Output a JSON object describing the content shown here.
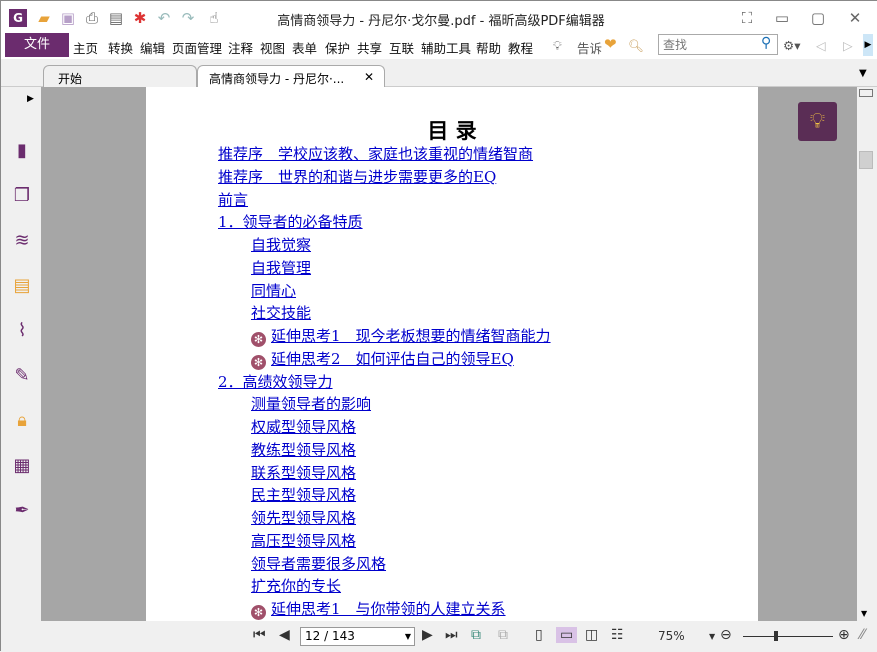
{
  "window": {
    "title": "高情商领导力 - 丹尼尔·戈尔曼.pdf - 福昕高级PDF编辑器"
  },
  "menu": {
    "file": "文件",
    "items": [
      "主页",
      "转换",
      "编辑",
      "页面管理",
      "注释",
      "视图",
      "表单",
      "保护",
      "共享",
      "互联",
      "辅助工具",
      "帮助",
      "教程"
    ],
    "tell": "告诉",
    "search_placeholder": "查找"
  },
  "tabs": [
    {
      "label": "开始"
    },
    {
      "label": "高情商领导力 - 丹尼尔·..."
    }
  ],
  "doc": {
    "title": "目 录",
    "entries": [
      {
        "text": "推荐序　学校应该教、家庭也该重视的情绪智商",
        "level": 0
      },
      {
        "text": "推荐序　世界的和谐与进步需要更多的EQ",
        "level": 0
      },
      {
        "text": "前言",
        "level": 0
      },
      {
        "text": "1．领导者的必备特质",
        "level": 0
      },
      {
        "text": "自我觉察",
        "level": 1
      },
      {
        "text": "自我管理",
        "level": 1
      },
      {
        "text": "同情心",
        "level": 1
      },
      {
        "text": "社交技能",
        "level": 1
      },
      {
        "text": "延伸思考1　现今老板想要的情绪智商能力",
        "level": 1,
        "bullet": true
      },
      {
        "text": "延伸思考2　如何评估自己的领导EQ",
        "level": 1,
        "bullet": true
      },
      {
        "text": "2．高绩效领导力",
        "level": 0
      },
      {
        "text": "测量领导者的影响",
        "level": 1
      },
      {
        "text": "权威型领导风格",
        "level": 1
      },
      {
        "text": "教练型领导风格",
        "level": 1
      },
      {
        "text": "联系型领导风格",
        "level": 1
      },
      {
        "text": "民主型领导风格",
        "level": 1
      },
      {
        "text": "领先型领导风格",
        "level": 1
      },
      {
        "text": "高压型领导风格",
        "level": 1
      },
      {
        "text": "领导者需要很多风格",
        "level": 1
      },
      {
        "text": "扩充你的专长",
        "level": 1
      },
      {
        "text": "延伸思考1　与你带领的人建立关系",
        "level": 1,
        "bullet": true
      }
    ]
  },
  "status": {
    "page": "12 / 143",
    "zoom": "75%",
    "zoom_level": 75
  },
  "colors": {
    "brand": "#6b2c6e",
    "link": "#0000cc"
  }
}
